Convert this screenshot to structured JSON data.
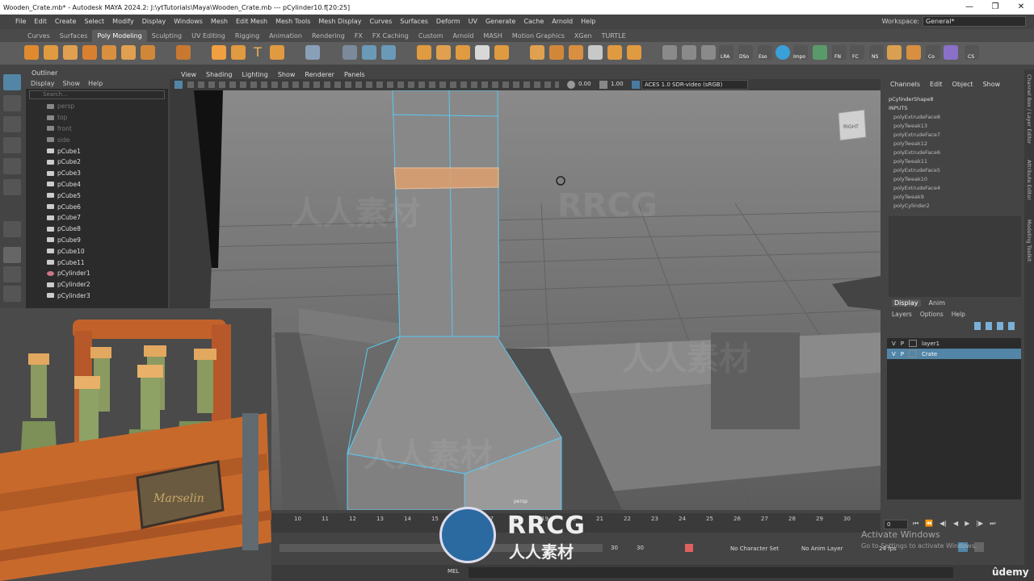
{
  "window": {
    "title": "Wooden_Crate.mb* - Autodesk MAYA 2024.2: J:\\ytTutorials\\Maya\\Wooden_Crate.mb   ---   pCylinder10.f[20:25]",
    "controls": [
      "—",
      "❐",
      "✕"
    ]
  },
  "menubar": {
    "items": [
      "File",
      "Edit",
      "Create",
      "Select",
      "Modify",
      "Display",
      "Windows",
      "Mesh",
      "Edit Mesh",
      "Mesh Tools",
      "Mesh Display",
      "Curves",
      "Surfaces",
      "Deform",
      "UV",
      "Generate",
      "Cache",
      "Arnold",
      "Help"
    ],
    "workspace_label": "Workspace:",
    "workspace_value": "General*"
  },
  "shelf": {
    "tabs": [
      "Curves",
      "Surfaces",
      "Poly Modeling",
      "Sculpting",
      "UV Editing",
      "Rigging",
      "Animation",
      "Rendering",
      "FX",
      "FX Caching",
      "Custom",
      "Arnold",
      "MASH",
      "Motion Graphics",
      "XGen",
      "TURTLE"
    ],
    "active_tab": "Poly Modeling",
    "icon_labels": [
      "LRA",
      "DSo",
      "Eso",
      "Impo",
      "FN",
      "FC",
      "NS",
      "Co",
      "CS"
    ],
    "accent_color": "#f0a040"
  },
  "outliner": {
    "title": "Outliner",
    "menu": [
      "Display",
      "Show",
      "Help"
    ],
    "search_placeholder": "Search...",
    "cameras": [
      "persp",
      "top",
      "front",
      "side"
    ],
    "items": [
      "pCube1",
      "pCube2",
      "pCube3",
      "pCube4",
      "pCube5",
      "pCube6",
      "pCube7",
      "pCube8",
      "pCube9",
      "pCube10",
      "pCube11",
      "pCylinder1",
      "pCylinder2",
      "pCylinder3"
    ]
  },
  "viewport": {
    "menu": [
      "View",
      "Shading",
      "Lighting",
      "Show",
      "Renderer",
      "Panels"
    ],
    "exposure": "0.00",
    "gamma": "1.00",
    "color_space": "ACES 1.0 SDR-video (sRGB)",
    "camera_label": "persp",
    "viewcube_label": "RIGHT",
    "selection_color": "#e0a070",
    "wire_color": "#5ac8f0"
  },
  "channel_box": {
    "menu": [
      "Channels",
      "Edit",
      "Object",
      "Show"
    ],
    "shape": "pCylinderShape8",
    "inputs_label": "INPUTS",
    "inputs": [
      "polyExtrudeFace8",
      "polyTweak13",
      "polyExtrudeFace7",
      "polyTweak12",
      "polyExtrudeFace6",
      "polyTweak11",
      "polyExtrudeFace5",
      "polyTweak10",
      "polyExtrudeFace4",
      "polyTweak9",
      "polyCylinder2"
    ]
  },
  "side_tabs": [
    "Channel Box / Layer Editor",
    "Attribute Editor",
    "Modeling Toolkit"
  ],
  "layer_editor": {
    "tabs": [
      "Display",
      "Anim"
    ],
    "menu": [
      "Layers",
      "Options",
      "Help"
    ],
    "layers": [
      {
        "v": "V",
        "p": "P",
        "name": "layer1",
        "selected": false
      },
      {
        "v": "V",
        "p": "P",
        "name": "Crate",
        "selected": true
      }
    ],
    "selected_color": "#5285a6"
  },
  "timeline": {
    "frames": [
      "10",
      "11",
      "12",
      "13",
      "14",
      "15",
      "16",
      "17",
      "18",
      "19",
      "20",
      "21",
      "22",
      "23",
      "24",
      "25",
      "26",
      "27",
      "28",
      "29",
      "30"
    ],
    "current_frame": "0",
    "range_end_a": "30",
    "range_end_b": "30",
    "character_set": "No Character Set",
    "anim_layer": "No Anim Layer",
    "fps": "24 fps"
  },
  "command_line": {
    "label": "MEL"
  },
  "overlays": {
    "watermark": "RRCG",
    "watermark_cn": "人人素材",
    "activate_title": "Activate Windows",
    "activate_sub": "Go to Settings to activate Windows.",
    "udemy": "ûdemy",
    "inset_plaque": "Marselin"
  }
}
